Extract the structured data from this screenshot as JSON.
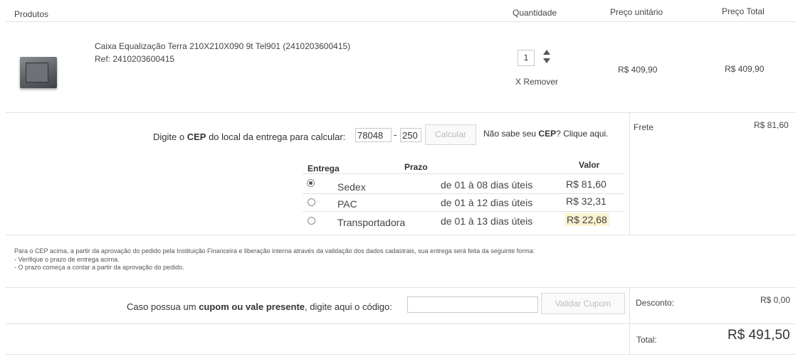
{
  "header": {
    "produtos": "Produtos",
    "quantidade": "Quantidade",
    "preco_unitario": "Preço unitário",
    "preco_total": "Preço Total"
  },
  "product": {
    "name": "Caixa Equalização Terra 210X210X090 9t Tel901 (2410203600415)",
    "ref": "Ref: 2410203600415",
    "quantity": "1",
    "remove_label": "X Remover",
    "unit_price": "R$ 409,90",
    "total_price": "R$ 409,90"
  },
  "cep": {
    "prompt_prefix": "Digite o",
    "prompt_bold": "CEP",
    "prompt_suffix": "do local da entrega para calcular:",
    "part1": "78048",
    "separator": "-",
    "part2": "250",
    "calc_button": "Calcular",
    "help_prefix": "Não sabe seu",
    "help_bold": "CEP",
    "help_suffix": "? Clique aqui."
  },
  "frete": {
    "label": "Frete",
    "value": "R$ 81,60"
  },
  "shipping": {
    "headers": {
      "entrega": "Entrega",
      "prazo": "Prazo",
      "valor": "Valor"
    },
    "options": [
      {
        "name": "Sedex",
        "prazo": "de 01 à 08 dias úteis",
        "valor": "R$ 81,60",
        "selected": true
      },
      {
        "name": "PAC",
        "prazo": "de 01 à 12 dias úteis",
        "valor": "R$ 32,31",
        "selected": false
      },
      {
        "name": "Transportadora",
        "prazo": "de 01 à 13 dias úteis",
        "valor": "R$ 22,68",
        "selected": false
      }
    ]
  },
  "notice": {
    "line1": "Para o CEP acima, a partir da aprovação do pedido pela Instituição Financeira e liberação interna através da validação dos dados cadastrais, sua entrega será feita da seguinte forma:",
    "line2": "- Verifique o prazo de entrega acima.",
    "line3": "- O prazo começa a contar a partir da aprovação do pedido."
  },
  "coupon": {
    "prompt_prefix": "Caso possua um",
    "prompt_bold": "cupom ou vale presente",
    "prompt_suffix": ", digite aqui o código:",
    "input_value": "",
    "validate_button": "Validar Cupom"
  },
  "desconto": {
    "label": "Desconto:",
    "value": "R$ 0,00"
  },
  "total": {
    "label": "Total:",
    "value": "R$ 491,50"
  },
  "colors": {
    "highlight": "#fbf3d0",
    "line": "#e2e2e2"
  }
}
